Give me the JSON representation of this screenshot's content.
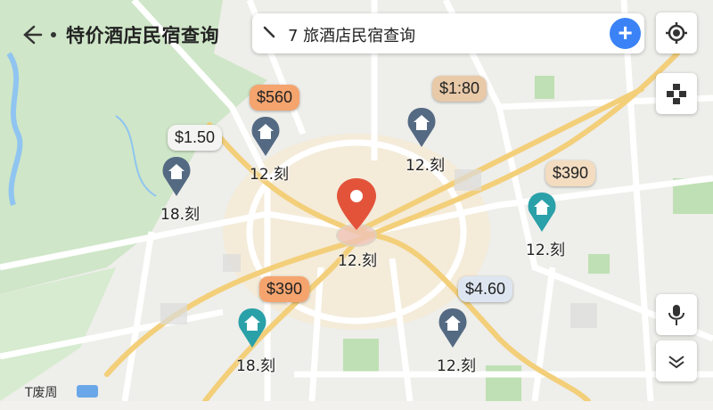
{
  "header": {
    "title": "特价酒店民宿查询",
    "search_text": "7  旅酒店民宿查询",
    "add_label": "+"
  },
  "markers": [
    {
      "id": "m1",
      "price": "$1.50",
      "label": "18.刻",
      "pin_color": "#546a83",
      "bubble_color": "#f4f4f2"
    },
    {
      "id": "m2",
      "price": "$560",
      "label": "12.刻",
      "pin_color": "#546a83",
      "bubble_color": "#f5a46e"
    },
    {
      "id": "m3",
      "price": "$1:80",
      "label": "12.刻",
      "pin_color": "#546a83",
      "bubble_color": "#e8c9a8"
    },
    {
      "id": "m4",
      "price": "$390",
      "label": "12.刻",
      "pin_color": "#2aa0a8",
      "bubble_color": "#f3dcc0"
    },
    {
      "id": "m5",
      "price": "$390",
      "label": "18.刻",
      "pin_color": "#2aa0a8",
      "bubble_color": "#f5a46e"
    },
    {
      "id": "m6",
      "price": "$4.60",
      "label": "12.刻",
      "pin_color": "#546a83",
      "bubble_color": "#dde6f0"
    }
  ],
  "current_location": {
    "label": "12.刻",
    "pin_color": "#e2533a"
  },
  "footer": {
    "text": "T废周"
  },
  "icons": [
    "back-arrow-icon",
    "search-icon",
    "add-icon",
    "locate-icon",
    "layers-icon",
    "microphone-icon",
    "chevron-down-icon",
    "home-icon",
    "location-pin-icon"
  ],
  "colors": {
    "accent": "#3b82f6",
    "road_major": "#f6cf72",
    "park": "#cde6c4",
    "water": "#8fc5f0"
  }
}
